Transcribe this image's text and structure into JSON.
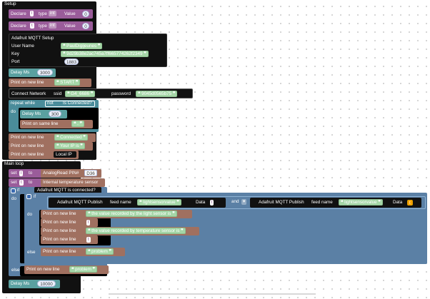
{
  "setup": {
    "label": "Setup",
    "declare1": {
      "declare": "Declare",
      "var": "l",
      "type_label": "type",
      "type": "int",
      "value_label": "Value",
      "value": "0"
    },
    "declare2": {
      "declare": "Declare",
      "var": "t",
      "type_label": "type",
      "type": "int",
      "value_label": "Value",
      "value": "0"
    },
    "mqtt": {
      "title": "Adafruit MQTT Setup",
      "user_label": "User Name",
      "user": "PaulDigijeunes",
      "key_label": "Key",
      "key": "9d29b38e2ac745a7ff665774262f2349",
      "port_label": "Port",
      "port": "1883"
    },
    "delay1": {
      "label": "Delay Ms",
      "value": "3000"
    },
    "print_start": {
      "label": "Print on new line",
      "value": "START"
    },
    "connect": {
      "label": "Connect Network",
      "ssid_label": "ssid",
      "ssid": "G4_6686",
      "password_label": "password",
      "password": "9045d0565b75"
    },
    "repeat": {
      "label": "repeat while",
      "not": "not",
      "cond": "Is Connected?",
      "do": "do"
    },
    "delay2": {
      "label": "Delay Ms",
      "value": "300"
    },
    "print_dot": {
      "label": "Print on same line",
      "value": "."
    },
    "print_connected": {
      "label": "Print on new line",
      "value": "Connected"
    },
    "print_ip": {
      "label": "Print on new line",
      "value": "Your IP is"
    },
    "print_local": {
      "label": "Print on new line",
      "value": "Local IP"
    }
  },
  "loop": {
    "label": "Main loop",
    "set1": {
      "set": "set",
      "var": "l",
      "to": "to",
      "value": "AnalogRead PIN#",
      "pin": "D36"
    },
    "set2": {
      "set": "set",
      "var": "t",
      "to": "to",
      "value": "Internal temperature sensor"
    },
    "if1": {
      "if": "if",
      "cond": "Adafruit MQTT is connected?",
      "do": "do",
      "else": "else"
    },
    "if2": {
      "if": "if",
      "do": "do",
      "else": "else",
      "and": "and"
    },
    "publish1": {
      "label": "Adafruit MQTT Publish",
      "feed_label": "feed name",
      "feed": "lightsensorvalue",
      "data_label": "Data",
      "data": "l"
    },
    "publish2": {
      "label": "Adafruit MQTT Publish",
      "feed_label": "feed name",
      "feed": "lightsensorvalue",
      "data_label": "Data",
      "data": "t"
    },
    "p1": {
      "label": "Print on new line",
      "value": "the value recorded by the light sensor is"
    },
    "p2": {
      "label": "Print on new line",
      "value": "l"
    },
    "p3": {
      "label": "Print on new line",
      "value": "the value recorded by temperature sensor is"
    },
    "p4": {
      "label": "Print on new line",
      "value": "t"
    },
    "p_problem1": {
      "label": "Print on new line",
      "value": "problem"
    },
    "p_problem2": {
      "label": "Print on new line",
      "value": "problem"
    },
    "delay": {
      "label": "Delay Ms",
      "value": "10000"
    }
  },
  "quote_open": "❝",
  "quote_close": "❞",
  "dropdown_arrow": "▾",
  "colors": {
    "black": "#111111",
    "purple": "#9a5c9a",
    "teal": "#5aa0a0",
    "brown": "#a07060",
    "blue": "#5b80a5",
    "string": "#a5d6a7"
  }
}
